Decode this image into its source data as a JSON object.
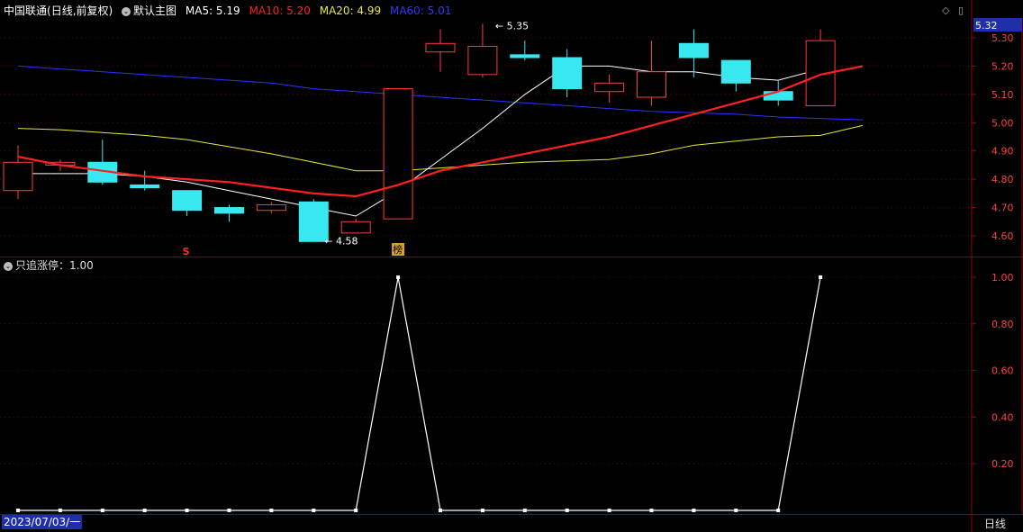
{
  "header": {
    "stock": "中国联通",
    "mode": "(日线,前复权)",
    "main_label": "默认主图",
    "ma5": {
      "label": "MA5: 5.19",
      "color": "#ffffff"
    },
    "ma10": {
      "label": "MA10: 5.20",
      "color": "#ff2020"
    },
    "ma20": {
      "label": "MA20: 4.99",
      "color": "#e8e83a"
    },
    "ma60": {
      "label": "MA60: 5.01",
      "color": "#3030ff"
    }
  },
  "sub_header": {
    "indicator": "只追涨停：1.00"
  },
  "footer": {
    "date": "2023/07/03/一",
    "period": "日线"
  },
  "price_axis": {
    "ticks": [
      "5.30",
      "5.20",
      "5.10",
      "5.00",
      "4.90",
      "4.80",
      "4.70",
      "4.60"
    ],
    "current": "5.32"
  },
  "indicator_axis": {
    "ticks": [
      "1.00",
      "0.80",
      "0.60",
      "0.40",
      "0.20"
    ]
  },
  "annotations": {
    "high": "5.35",
    "low": "4.58",
    "marker_s": "S",
    "marker_bang": "榜"
  },
  "colors": {
    "up": "#ff3b3b",
    "down": "#38e8f0",
    "grid": "#7a0000",
    "axis_text": "#ff4040"
  },
  "chart_data": {
    "type": "candlestick",
    "price_range": [
      4.55,
      5.35
    ],
    "candles": [
      {
        "open": 4.76,
        "close": 4.86,
        "high": 4.92,
        "low": 4.73
      },
      {
        "open": 4.85,
        "close": 4.86,
        "high": 4.87,
        "low": 4.83
      },
      {
        "open": 4.86,
        "close": 4.79,
        "high": 4.94,
        "low": 4.78
      },
      {
        "open": 4.78,
        "close": 4.77,
        "high": 4.83,
        "low": 4.76
      },
      {
        "open": 4.76,
        "close": 4.69,
        "high": 4.76,
        "low": 4.67
      },
      {
        "open": 4.7,
        "close": 4.68,
        "high": 4.71,
        "low": 4.65
      },
      {
        "open": 4.69,
        "close": 4.71,
        "high": 4.72,
        "low": 4.68
      },
      {
        "open": 4.72,
        "close": 4.58,
        "high": 4.73,
        "low": 4.58
      },
      {
        "open": 4.61,
        "close": 4.65,
        "high": 4.66,
        "low": 4.61
      },
      {
        "open": 4.66,
        "close": 5.12,
        "high": 5.12,
        "low": 4.66
      },
      {
        "open": 5.25,
        "close": 5.28,
        "high": 5.33,
        "low": 5.18
      },
      {
        "open": 5.17,
        "close": 5.27,
        "high": 5.35,
        "low": 5.16
      },
      {
        "open": 5.24,
        "close": 5.23,
        "high": 5.29,
        "low": 5.22
      },
      {
        "open": 5.23,
        "close": 5.12,
        "high": 5.26,
        "low": 5.09
      },
      {
        "open": 5.11,
        "close": 5.14,
        "high": 5.17,
        "low": 5.07
      },
      {
        "open": 5.09,
        "close": 5.18,
        "high": 5.29,
        "low": 5.06
      },
      {
        "open": 5.28,
        "close": 5.23,
        "high": 5.33,
        "low": 5.16
      },
      {
        "open": 5.22,
        "close": 5.14,
        "high": 5.22,
        "low": 5.11
      },
      {
        "open": 5.11,
        "close": 5.08,
        "high": 5.15,
        "low": 5.06
      },
      {
        "open": 5.06,
        "close": 5.29,
        "high": 5.33,
        "low": 5.06
      }
    ],
    "ma5": [
      4.82,
      4.82,
      4.82,
      4.81,
      4.79,
      4.76,
      4.73,
      4.7,
      4.67,
      4.76,
      4.87,
      4.98,
      5.1,
      5.2,
      5.2,
      5.18,
      5.18,
      5.16,
      5.15,
      5.19
    ],
    "ma10": [
      4.88,
      4.85,
      4.83,
      4.81,
      4.8,
      4.79,
      4.77,
      4.75,
      4.74,
      4.78,
      4.83,
      4.86,
      4.89,
      4.92,
      4.95,
      4.99,
      5.03,
      5.07,
      5.11,
      5.17,
      5.2
    ],
    "ma20": [
      4.98,
      4.975,
      4.965,
      4.955,
      4.94,
      4.915,
      4.89,
      4.86,
      4.83,
      4.83,
      4.84,
      4.85,
      4.86,
      4.865,
      4.87,
      4.89,
      4.92,
      4.935,
      4.95,
      4.955,
      4.99
    ],
    "ma60": [
      5.2,
      5.19,
      5.18,
      5.17,
      5.16,
      5.15,
      5.14,
      5.12,
      5.11,
      5.1,
      5.09,
      5.08,
      5.07,
      5.06,
      5.05,
      5.04,
      5.035,
      5.03,
      5.02,
      5.015,
      5.01
    ],
    "indicator": {
      "name": "只追涨停",
      "range": [
        0,
        1
      ],
      "values": [
        0,
        0,
        0,
        0,
        0,
        0,
        0,
        0,
        0,
        1,
        0,
        0,
        0,
        0,
        0,
        0,
        0,
        0,
        0,
        1
      ]
    }
  }
}
